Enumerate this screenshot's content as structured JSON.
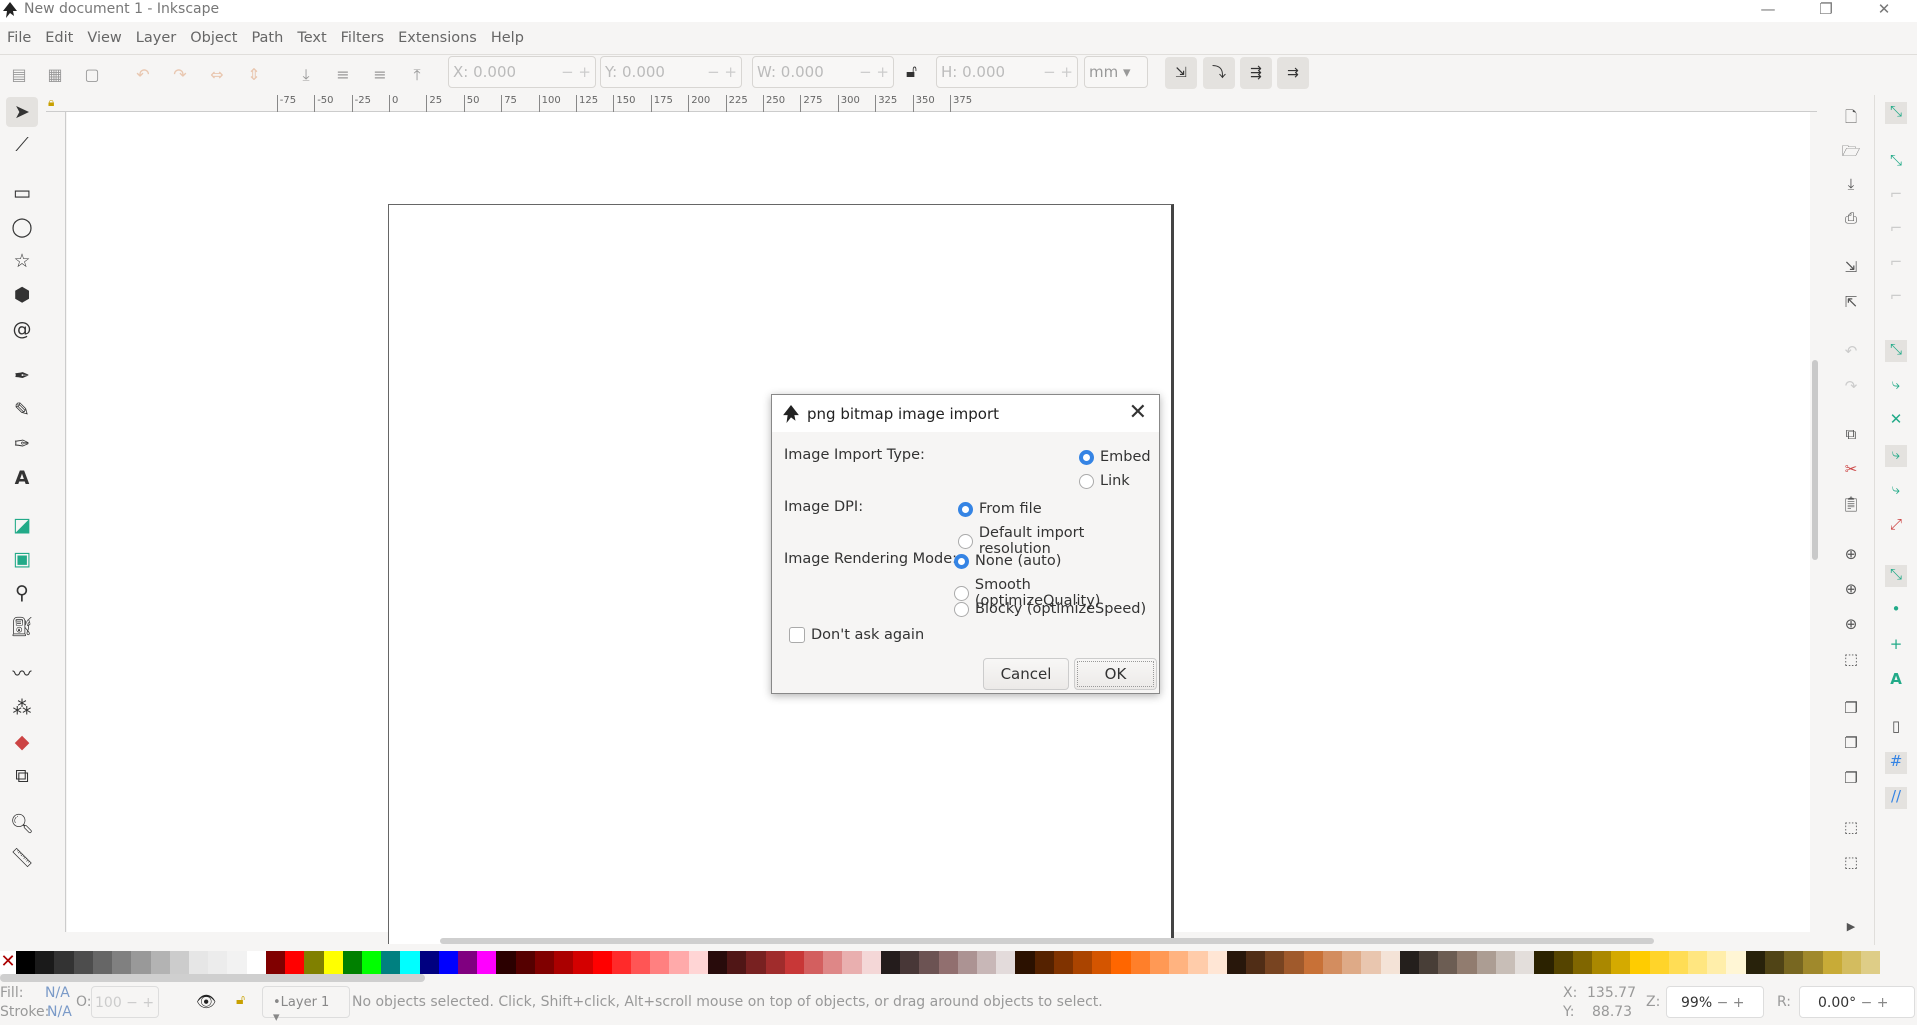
{
  "window": {
    "title": "New document 1 - Inkscape",
    "minimize": "—",
    "maximize": "❐",
    "close": "✕"
  },
  "menu": [
    "File",
    "Edit",
    "View",
    "Layer",
    "Object",
    "Path",
    "Text",
    "Filters",
    "Extensions",
    "Help"
  ],
  "toolbar": {
    "x_label": "X:",
    "x": "0.000",
    "y_label": "Y:",
    "y": "0.000",
    "w_label": "W:",
    "w": "0.000",
    "h_label": "H:",
    "h": "0.000",
    "unit": "mm",
    "minus": "−",
    "plus": "+"
  },
  "ruler_ticks": [
    "-75",
    "-50",
    "-25",
    "0",
    "25",
    "50",
    "75",
    "100",
    "125",
    "150",
    "175",
    "200",
    "225",
    "250",
    "275",
    "300",
    "325",
    "350",
    "375"
  ],
  "dialog": {
    "title": "png bitmap image import",
    "import_type_label": "Image Import Type:",
    "import_type_options": [
      {
        "label": "Embed",
        "checked": true
      },
      {
        "label": "Link",
        "checked": false
      }
    ],
    "dpi_label": "Image DPI:",
    "dpi_options": [
      {
        "label": "From file",
        "checked": true
      },
      {
        "label": "Default import resolution",
        "checked": false
      }
    ],
    "render_label": "Image Rendering Mode:",
    "render_options": [
      {
        "label": "None (auto)",
        "checked": true
      },
      {
        "label": "Smooth (optimizeQuality)",
        "checked": false
      },
      {
        "label": "Blocky (optimizeSpeed)",
        "checked": false
      }
    ],
    "dont_ask": "Don't ask again",
    "dont_ask_checked": false,
    "cancel": "Cancel",
    "ok": "OK"
  },
  "status": {
    "fill_label": "Fill:",
    "fill": "N/A",
    "stroke_label": "Stroke:",
    "stroke": "N/A",
    "opacity_label": "O:",
    "opacity": "100",
    "layer": "•Layer 1",
    "message": "No objects selected. Click, Shift+click, Alt+scroll mouse on top of objects, or drag around objects to select.",
    "x_label": "X:",
    "x": "135.77",
    "y_label": "Y:",
    "y": "88.73",
    "zoom_label": "Z:",
    "zoom": "99%",
    "rot_label": "R:",
    "rotation": "0.00°"
  },
  "accent": "#3584e4",
  "palette": [
    "#000000",
    "#1a1a1a",
    "#333333",
    "#4d4d4d",
    "#666666",
    "#808080",
    "#999999",
    "#b3b3b3",
    "#cccccc",
    "#e6e6e6",
    "#ececec",
    "#f2f2f2",
    "#ffffff",
    "#800000",
    "#ff0000",
    "#808000",
    "#ffff00",
    "#008000",
    "#00ff00",
    "#008080",
    "#00ffff",
    "#000080",
    "#0000ff",
    "#800080",
    "#ff00ff",
    "#2b0000",
    "#550000",
    "#800000",
    "#aa0000",
    "#d40000",
    "#ff0000",
    "#ff2a2a",
    "#ff5555",
    "#ff8080",
    "#ffaaaa",
    "#ffd5d5",
    "#280b0b",
    "#501616",
    "#782121",
    "#a02c2c",
    "#c83737",
    "#d35f5f",
    "#de8787",
    "#e9afaf",
    "#f4d7d7",
    "#241c1c",
    "#483737",
    "#6c5353",
    "#916f6f",
    "#ac9393",
    "#c8b7b7",
    "#e3dbdb",
    "#2b1100",
    "#552200",
    "#803300",
    "#aa4400",
    "#d45500",
    "#ff6600",
    "#ff7f2a",
    "#ff9955",
    "#ffb380",
    "#ffccaa",
    "#ffe6d5",
    "#28170b",
    "#502d16",
    "#784421",
    "#a05a2c",
    "#c87137",
    "#d38d5f",
    "#deaa87",
    "#e9c6af",
    "#f4e3d7",
    "#241f1c",
    "#483e37",
    "#6c5d53",
    "#917c6f",
    "#ac9d93",
    "#c8beb7",
    "#e3dedb",
    "#2b2200",
    "#554400",
    "#806600",
    "#aa8800",
    "#d4aa00",
    "#ffcc00",
    "#ffd42a",
    "#ffdd55",
    "#ffe680",
    "#ffeeaa",
    "#fff6d5",
    "#28220b",
    "#504416",
    "#786721",
    "#a0892c",
    "#c8ab37",
    "#d3bc5f",
    "#decd87"
  ]
}
